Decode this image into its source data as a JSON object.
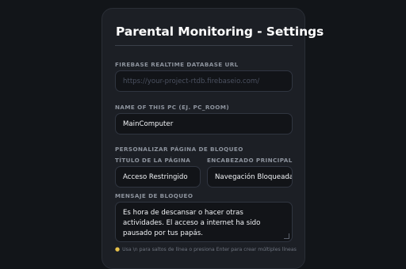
{
  "settings": {
    "title": "Parental Monitoring - Settings",
    "firebase_url": {
      "label": "FIREBASE REALTIME DATABASE URL",
      "placeholder": "https://your-project-rtdb.firebaseio.com/",
      "value": ""
    },
    "pc_name": {
      "label": "NAME OF THIS PC (EJ. PC_ROOM)",
      "value": "MainComputer"
    },
    "block_page": {
      "section_label": "PERSONALIZAR PÁGINA DE BLOQUEO",
      "page_title": {
        "label": "TÍTULO DE LA PÁGINA",
        "value": "Acceso Restringido"
      },
      "main_header": {
        "label": "ENCABEZADO PRINCIPAL",
        "value": "Navegación Bloqueada"
      },
      "block_message": {
        "label": "MENSAJE DE BLOQUEO",
        "value": "Es hora de descansar o hacer otras actividades. El acceso a internet ha sido pausado por tus papás."
      },
      "hint": "Usa \\n para saltos de línea o presiona Enter para crear múltiples líneas",
      "hint_icon": "lightbulb-icon"
    }
  }
}
